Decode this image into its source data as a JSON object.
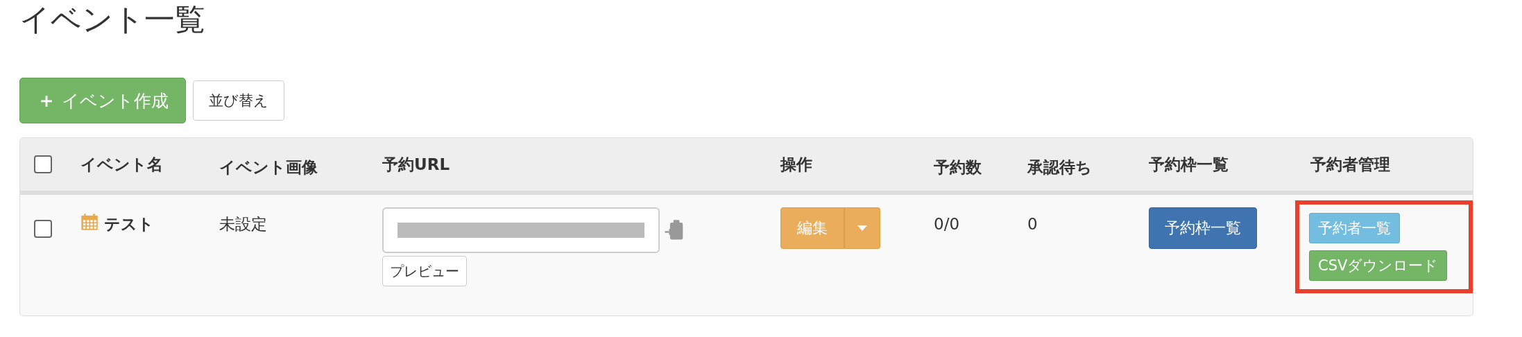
{
  "page_title": "イベント一覧",
  "toolbar": {
    "create_button": {
      "icon": "＋",
      "label": "イベント作成"
    },
    "sort_button": "並び替え"
  },
  "table": {
    "select_all_checked": false,
    "columns": [
      "イベント名",
      "イベント画像",
      "予約URL",
      "操作",
      "予約数",
      "承認待ち",
      "予約枠一覧",
      "予約者管理"
    ],
    "rows": [
      {
        "checked": false,
        "name": "テスト",
        "image": "未設定",
        "url_redacted": true,
        "preview_button": "プレビュー",
        "edit_button": "編集",
        "reservations": "0/0",
        "pending": "0",
        "slots_button": "予約枠一覧",
        "manage_buttons": [
          "予約者一覧",
          "CSVダウンロード"
        ],
        "manage_highlighted": true
      }
    ]
  }
}
